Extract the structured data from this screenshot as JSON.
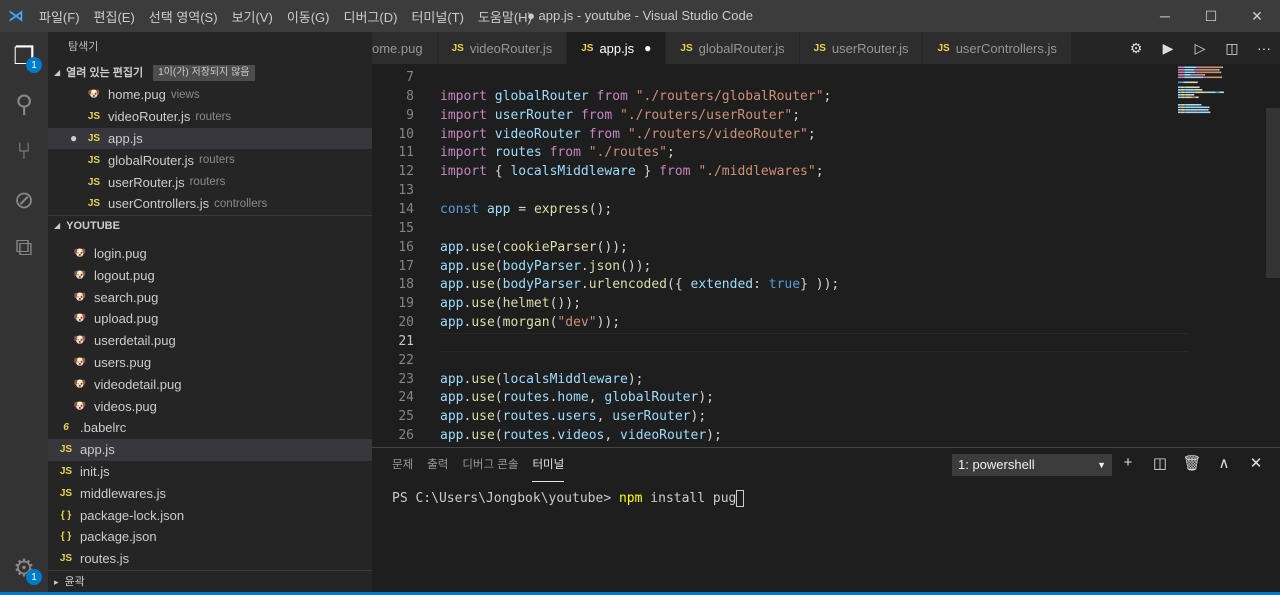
{
  "window": {
    "title": "● app.js - youtube - Visual Studio Code",
    "minimize": "─",
    "maximize": "☐",
    "close": "✕"
  },
  "menu": [
    "파일(F)",
    "편집(E)",
    "선택 영역(S)",
    "보기(V)",
    "이동(G)",
    "디버그(D)",
    "터미널(T)",
    "도움말(H)"
  ],
  "activity": [
    {
      "icon": "files-icon",
      "glyph": "❐",
      "badge": "1",
      "active": true
    },
    {
      "icon": "search-icon",
      "glyph": "⚲"
    },
    {
      "icon": "source-control-icon",
      "glyph": "⑂"
    },
    {
      "icon": "debug-icon",
      "glyph": "⊘"
    },
    {
      "icon": "extensions-icon",
      "glyph": "⧉"
    }
  ],
  "settings": {
    "icon": "gear-icon",
    "glyph": "⚙",
    "badge": "1"
  },
  "sidebar": {
    "title": "탐색기",
    "open_editors": {
      "label": "열려 있는 편집기",
      "dirty": "1이(가) 저장되지 않음",
      "items": [
        {
          "name": "home.pug",
          "desc": "views",
          "type": "pug"
        },
        {
          "name": "videoRouter.js",
          "desc": "routers",
          "type": "js"
        },
        {
          "name": "app.js",
          "desc": "",
          "type": "js",
          "dirty": true,
          "selected": true
        },
        {
          "name": "globalRouter.js",
          "desc": "routers",
          "type": "js"
        },
        {
          "name": "userRouter.js",
          "desc": "routers",
          "type": "js"
        },
        {
          "name": "userControllers.js",
          "desc": "controllers",
          "type": "js"
        }
      ]
    },
    "folder": {
      "label": "YOUTUBE",
      "items": [
        {
          "name": "login.pug",
          "type": "pug",
          "indent": 1
        },
        {
          "name": "logout.pug",
          "type": "pug",
          "indent": 1
        },
        {
          "name": "search.pug",
          "type": "pug",
          "indent": 1
        },
        {
          "name": "upload.pug",
          "type": "pug",
          "indent": 1
        },
        {
          "name": "userdetail.pug",
          "type": "pug",
          "indent": 1
        },
        {
          "name": "users.pug",
          "type": "pug",
          "indent": 1
        },
        {
          "name": "videodetail.pug",
          "type": "pug",
          "indent": 1
        },
        {
          "name": "videos.pug",
          "type": "pug",
          "indent": 1
        },
        {
          "name": ".babelrc",
          "type": "babel",
          "indent": 0
        },
        {
          "name": "app.js",
          "type": "js",
          "indent": 0,
          "selected": true
        },
        {
          "name": "init.js",
          "type": "js",
          "indent": 0
        },
        {
          "name": "middlewares.js",
          "type": "js",
          "indent": 0
        },
        {
          "name": "package-lock.json",
          "type": "json",
          "indent": 0
        },
        {
          "name": "package.json",
          "type": "json",
          "indent": 0
        },
        {
          "name": "routes.js",
          "type": "js",
          "indent": 0
        }
      ]
    },
    "outline": "윤곽"
  },
  "tabs": [
    {
      "label": "ome.pug",
      "type": "pug"
    },
    {
      "label": "videoRouter.js",
      "type": "js"
    },
    {
      "label": "app.js",
      "type": "js",
      "active": true,
      "dirty": true
    },
    {
      "label": "globalRouter.js",
      "type": "js"
    },
    {
      "label": "userRouter.js",
      "type": "js"
    },
    {
      "label": "userControllers.js",
      "type": "js"
    }
  ],
  "editor_actions": [
    {
      "icon": "gear-icon",
      "glyph": "⚙"
    },
    {
      "icon": "run-icon",
      "glyph": "▶"
    },
    {
      "icon": "run-alt-icon",
      "glyph": "▷"
    },
    {
      "icon": "split-editor-icon",
      "glyph": "◫"
    },
    {
      "icon": "more-icon",
      "glyph": "···"
    }
  ],
  "code": {
    "current_line": 21,
    "lines": [
      {
        "n": 7,
        "t": []
      },
      {
        "n": 8,
        "t": [
          [
            "import ",
            "kw"
          ],
          [
            "globalRouter ",
            "v"
          ],
          [
            "from ",
            "kw"
          ],
          [
            "\"./routers/globalRouter\"",
            "s"
          ],
          [
            ";",
            "p"
          ]
        ]
      },
      {
        "n": 9,
        "t": [
          [
            "import ",
            "kw"
          ],
          [
            "userRouter ",
            "v"
          ],
          [
            "from ",
            "kw"
          ],
          [
            "\"./routers/userRouter\"",
            "s"
          ],
          [
            ";",
            "p"
          ]
        ]
      },
      {
        "n": 10,
        "t": [
          [
            "import ",
            "kw"
          ],
          [
            "videoRouter ",
            "v"
          ],
          [
            "from ",
            "kw"
          ],
          [
            "\"./routers/videoRouter\"",
            "s"
          ],
          [
            ";",
            "p"
          ]
        ]
      },
      {
        "n": 11,
        "t": [
          [
            "import ",
            "kw"
          ],
          [
            "routes ",
            "v"
          ],
          [
            "from ",
            "kw"
          ],
          [
            "\"./routes\"",
            "s"
          ],
          [
            ";",
            "p"
          ]
        ]
      },
      {
        "n": 12,
        "t": [
          [
            "import ",
            "kw"
          ],
          [
            "{ ",
            "p"
          ],
          [
            "localsMiddleware ",
            "v"
          ],
          [
            "} ",
            "p"
          ],
          [
            "from ",
            "kw"
          ],
          [
            "\"./middlewares\"",
            "s"
          ],
          [
            ";",
            "p"
          ]
        ]
      },
      {
        "n": 13,
        "t": []
      },
      {
        "n": 14,
        "t": [
          [
            "const ",
            "c"
          ],
          [
            "app ",
            "v"
          ],
          [
            "= ",
            "p"
          ],
          [
            "express",
            "f"
          ],
          [
            "();",
            "p"
          ]
        ]
      },
      {
        "n": 15,
        "t": []
      },
      {
        "n": 16,
        "t": [
          [
            "app",
            "v"
          ],
          [
            ".",
            "p"
          ],
          [
            "use",
            "f"
          ],
          [
            "(",
            "p"
          ],
          [
            "cookieParser",
            "f"
          ],
          [
            "());",
            "p"
          ]
        ]
      },
      {
        "n": 17,
        "t": [
          [
            "app",
            "v"
          ],
          [
            ".",
            "p"
          ],
          [
            "use",
            "f"
          ],
          [
            "(",
            "p"
          ],
          [
            "bodyParser",
            "v"
          ],
          [
            ".",
            "p"
          ],
          [
            "json",
            "f"
          ],
          [
            "());",
            "p"
          ]
        ]
      },
      {
        "n": 18,
        "t": [
          [
            "app",
            "v"
          ],
          [
            ".",
            "p"
          ],
          [
            "use",
            "f"
          ],
          [
            "(",
            "p"
          ],
          [
            "bodyParser",
            "v"
          ],
          [
            ".",
            "p"
          ],
          [
            "urlencoded",
            "f"
          ],
          [
            "({ ",
            "p"
          ],
          [
            "extended",
            "v"
          ],
          [
            ": ",
            "p"
          ],
          [
            "true",
            "c"
          ],
          [
            "} ));",
            "p"
          ]
        ]
      },
      {
        "n": 19,
        "t": [
          [
            "app",
            "v"
          ],
          [
            ".",
            "p"
          ],
          [
            "use",
            "f"
          ],
          [
            "(",
            "p"
          ],
          [
            "helmet",
            "f"
          ],
          [
            "());",
            "p"
          ]
        ]
      },
      {
        "n": 20,
        "t": [
          [
            "app",
            "v"
          ],
          [
            ".",
            "p"
          ],
          [
            "use",
            "f"
          ],
          [
            "(",
            "p"
          ],
          [
            "morgan",
            "f"
          ],
          [
            "(",
            "p"
          ],
          [
            "\"dev\"",
            "s"
          ],
          [
            "));",
            "p"
          ]
        ]
      },
      {
        "n": 21,
        "t": []
      },
      {
        "n": 22,
        "t": []
      },
      {
        "n": 23,
        "t": [
          [
            "app",
            "v"
          ],
          [
            ".",
            "p"
          ],
          [
            "use",
            "f"
          ],
          [
            "(",
            "p"
          ],
          [
            "localsMiddleware",
            "v"
          ],
          [
            ");",
            "p"
          ]
        ]
      },
      {
        "n": 24,
        "t": [
          [
            "app",
            "v"
          ],
          [
            ".",
            "p"
          ],
          [
            "use",
            "f"
          ],
          [
            "(",
            "p"
          ],
          [
            "routes",
            "v"
          ],
          [
            ".",
            "p"
          ],
          [
            "home",
            "v"
          ],
          [
            ", ",
            "p"
          ],
          [
            "globalRouter",
            "v"
          ],
          [
            ");",
            "p"
          ]
        ]
      },
      {
        "n": 25,
        "t": [
          [
            "app",
            "v"
          ],
          [
            ".",
            "p"
          ],
          [
            "use",
            "f"
          ],
          [
            "(",
            "p"
          ],
          [
            "routes",
            "v"
          ],
          [
            ".",
            "p"
          ],
          [
            "users",
            "v"
          ],
          [
            ", ",
            "p"
          ],
          [
            "userRouter",
            "v"
          ],
          [
            ");",
            "p"
          ]
        ]
      },
      {
        "n": 26,
        "t": [
          [
            "app",
            "v"
          ],
          [
            ".",
            "p"
          ],
          [
            "use",
            "f"
          ],
          [
            "(",
            "p"
          ],
          [
            "routes",
            "v"
          ],
          [
            ".",
            "p"
          ],
          [
            "videos",
            "v"
          ],
          [
            ", ",
            "p"
          ],
          [
            "videoRouter",
            "v"
          ],
          [
            ");",
            "p"
          ]
        ]
      }
    ]
  },
  "panel": {
    "tabs": [
      "문제",
      "출력",
      "디버그 콘솔",
      "터미널"
    ],
    "active_tab": 3,
    "terminal_select": "1: powershell",
    "actions": [
      {
        "icon": "plus-icon",
        "glyph": "+"
      },
      {
        "icon": "split-terminal-icon",
        "glyph": "◫"
      },
      {
        "icon": "trash-icon",
        "glyph": "🗑"
      },
      {
        "icon": "maximize-panel-icon",
        "glyph": "∧"
      },
      {
        "icon": "close-panel-icon",
        "glyph": "✕"
      }
    ],
    "prompt": "PS C:\\Users\\Jongbok\\youtube> ",
    "cmd": "npm",
    "args": " install pug"
  },
  "colors": {
    "accent": "#007acc",
    "editor_bg": "#1e1e1e",
    "sidebar_bg": "#252526",
    "activity_bg": "#333333"
  }
}
